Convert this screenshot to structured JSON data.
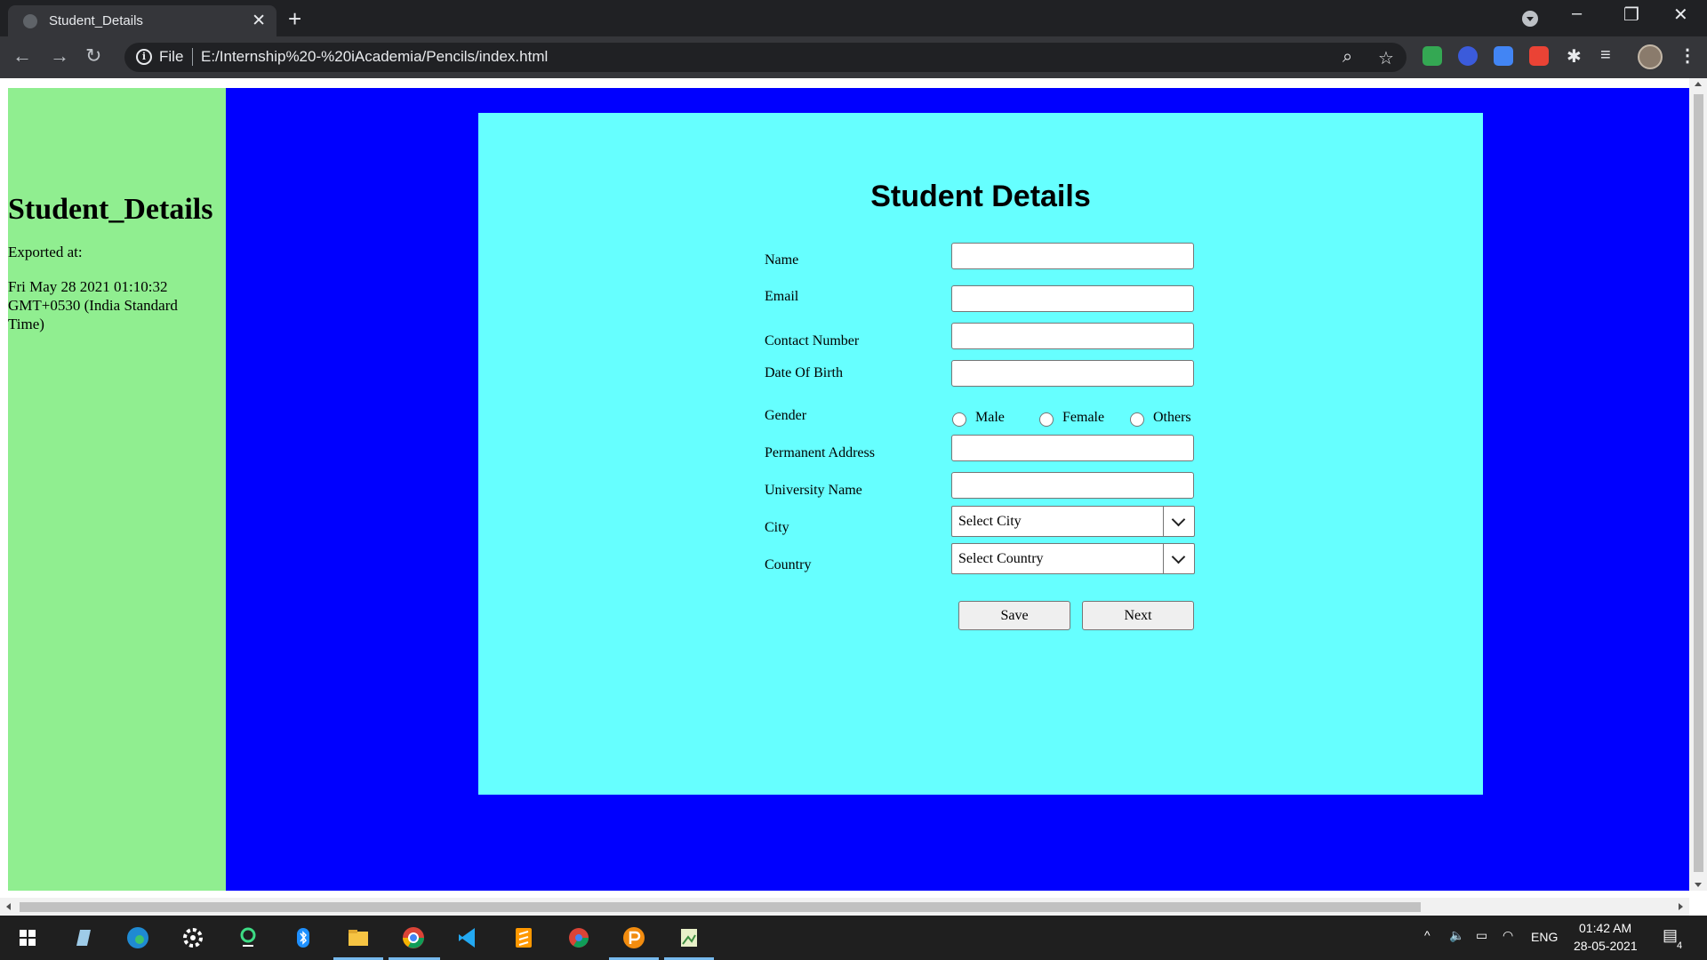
{
  "browser": {
    "tab_title": "Student_Details",
    "tab_close": "✕",
    "new_tab": "+",
    "scheme": "File",
    "url": "E:/Internship%20-%20iAcademia/Pencils/index.html"
  },
  "sidebar": {
    "title": "Student_Details",
    "exported_label": "Exported at:",
    "exported_time": "Fri May 28 2021 01:10:32 GMT+0530 (India Standard Time)"
  },
  "form": {
    "heading": "Student Details",
    "labels": {
      "name": "Name",
      "email": "Email",
      "contact": "Contact Number",
      "dob": "Date Of Birth",
      "gender": "Gender",
      "address": "Permanent Address",
      "university": "University Name",
      "city": "City",
      "country": "Country"
    },
    "values": {
      "name": "",
      "email": "",
      "contact": "",
      "dob": "",
      "address": "",
      "university": ""
    },
    "gender_options": [
      "Male",
      "Female",
      "Others"
    ],
    "city_selected": "Select City",
    "country_selected": "Select Country",
    "save_label": "Save",
    "next_label": "Next"
  },
  "taskbar": {
    "language": "ENG",
    "time": "01:42 AM",
    "date": "28-05-2021",
    "notifications": "4"
  },
  "colors": {
    "sidebar_bg": "#90ee90",
    "main_bg": "#0000ff",
    "card_bg": "#66ffff"
  }
}
